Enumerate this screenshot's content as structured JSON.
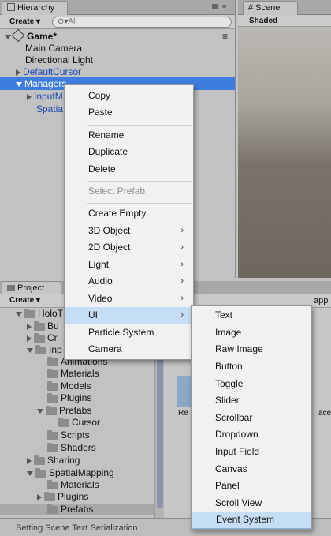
{
  "hierarchy": {
    "tab_label": "Hierarchy",
    "create_label": "Create",
    "search_placeholder": "All",
    "rows": [
      {
        "label": "Game*"
      },
      {
        "label": "Main Camera"
      },
      {
        "label": "Directional Light"
      },
      {
        "label": "DefaultCursor"
      },
      {
        "label": "Managers"
      },
      {
        "label": "InputM"
      },
      {
        "label": "Spatia"
      }
    ]
  },
  "scene": {
    "tab_label": "Scene",
    "shading_label": "Shaded"
  },
  "project": {
    "tab_label": "Project",
    "create_label": "Create",
    "tree": [
      {
        "label": "HoloT"
      },
      {
        "label": "Bu"
      },
      {
        "label": "Cr"
      },
      {
        "label": "Inp"
      },
      {
        "label": "Animations"
      },
      {
        "label": "Materials"
      },
      {
        "label": "Models"
      },
      {
        "label": "Plugins"
      },
      {
        "label": "Prefabs"
      },
      {
        "label": "Cursor"
      },
      {
        "label": "Scripts"
      },
      {
        "label": "Shaders"
      },
      {
        "label": "Sharing"
      },
      {
        "label": "SpatialMapping"
      },
      {
        "label": "Materials"
      },
      {
        "label": "Plugins"
      },
      {
        "label": "Prefabs"
      }
    ],
    "partial_labels": {
      "top_right": "app",
      "re": "Re",
      "ace": "ace"
    }
  },
  "status_bar": {
    "text": "Setting Scene Text Serialization"
  },
  "context_menu": {
    "items": [
      {
        "label": "Copy"
      },
      {
        "label": "Paste"
      },
      {
        "label": "Rename"
      },
      {
        "label": "Duplicate"
      },
      {
        "label": "Delete"
      },
      {
        "label": "Select Prefab"
      },
      {
        "label": "Create Empty"
      },
      {
        "label": "3D Object"
      },
      {
        "label": "2D Object"
      },
      {
        "label": "Light"
      },
      {
        "label": "Audio"
      },
      {
        "label": "Video"
      },
      {
        "label": "UI"
      },
      {
        "label": "Particle System"
      },
      {
        "label": "Camera"
      }
    ],
    "submenu_glyph": "›"
  },
  "ui_submenu": {
    "items": [
      {
        "label": "Text"
      },
      {
        "label": "Image"
      },
      {
        "label": "Raw Image"
      },
      {
        "label": "Button"
      },
      {
        "label": "Toggle"
      },
      {
        "label": "Slider"
      },
      {
        "label": "Scrollbar"
      },
      {
        "label": "Dropdown"
      },
      {
        "label": "Input Field"
      },
      {
        "label": "Canvas"
      },
      {
        "label": "Panel"
      },
      {
        "label": "Scroll View"
      },
      {
        "label": "Event System"
      }
    ]
  },
  "colors": {
    "selection": "#3e7ddf",
    "menu_highlight": "#c6def5",
    "prefab_text": "#1a48b4"
  }
}
